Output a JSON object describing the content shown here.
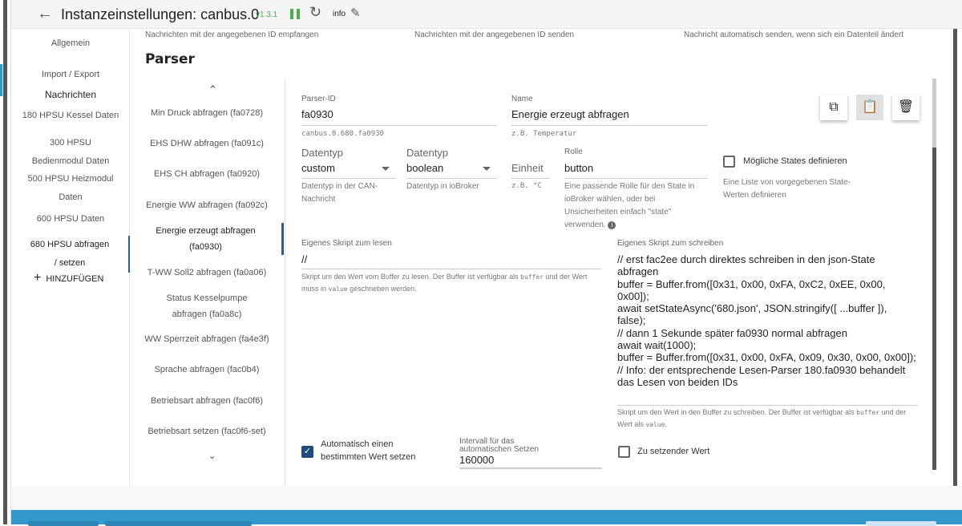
{
  "header": {
    "title": "Instanzeinstellungen: canbus.0",
    "version": "v1.3.1",
    "info": "info"
  },
  "nav": {
    "items": [
      "Allgemein",
      "Import / Export",
      "Nachrichten",
      "180 HPSU Kessel Daten",
      "300 HPSU Bedienmodul Daten",
      "500 HPSU Heizmodul Daten",
      "600 HPSU Daten",
      "680 HPSU abfragen / setzen"
    ],
    "add": "HINZUFÜGEN"
  },
  "top_desc": [
    "Nachrichten mit der angegebenen ID empfangen",
    "Nachrichten mit der angegebenen ID senden",
    "Nachricht automatisch senden, wenn sich ein Datenteil ändert"
  ],
  "section_title": "Parser",
  "parsers": [
    "Min Druck abfragen (fa0728)",
    "EHS DHW abfragen (fa091c)",
    "EHS CH abfragen (fa0920)",
    "Energie WW abfragen (fa092c)",
    "Energie erzeugt abfragen (fa0930)",
    "T-WW Soll2 abfragen (fa0a06)",
    "Status Kesselpumpe abfragen (fa0a8c)",
    "WW Sperrzeit abfragen (fa4e3f)",
    "Sprache abfragen (fac0b4)",
    "Betriebsart abfragen (fac0f6)",
    "Betriebsart setzen (fac0f6-set)"
  ],
  "form": {
    "parser_id": {
      "label": "Parser-ID",
      "value": "fa0930",
      "help": "canbus.0.680.fa0930"
    },
    "name": {
      "label": "Name",
      "value": "Energie erzeugt abfragen",
      "help": "z.B. Temperatur"
    },
    "can_type": {
      "label": "Datentyp",
      "value": "custom",
      "help": "Datentyp in der CAN-Nachricht"
    },
    "iob_type": {
      "label": "Datentyp",
      "value": "boolean",
      "help": "Datentyp in ioBroker"
    },
    "unit": {
      "label": "Einheit",
      "help": "z.B. °C"
    },
    "role": {
      "label": "Rolle",
      "value": "button",
      "help": "Eine passende Rolle für den State in ioBroker wählen, oder bei Unsicherheiten einfach \"state\" verwenden."
    },
    "states": {
      "label": "Mögliche States definieren",
      "help": "Eine Liste von vorgegebenen State-Werten definieren",
      "checked": false
    },
    "read_script": {
      "label": "Eigenes Skript zum lesen",
      "value": "//",
      "help_a": "Skript um den Wert vom Buffer zu lesen. Der Buffer ist verfügbar als ",
      "help_code1": "buffer",
      "help_b": " und der Wert muss in ",
      "help_code2": "value",
      "help_c": " geschrieben werden."
    },
    "write_script": {
      "label": "Eigenes Skript zum schreiben",
      "value": "// erst fac2ee durch direktes schreiben in den json-State abfragen\nbuffer = Buffer.from([0x31, 0x00, 0xFA, 0xC2, 0xEE, 0x00, 0x00]);\nawait setStateAsync('680.json', JSON.stringify([ ...buffer ]), false);\n// dann 1 Sekunde später fa0930 normal abfragen\nawait wait(1000);\nbuffer = Buffer.from([0x31, 0x00, 0xFA, 0x09, 0x30, 0x00, 0x00]);\n// Info: der entsprechende Lesen-Parser 180.fa0930 behandelt das Lesen von beiden IDs",
      "help_a": "Skript um den Wert in den Buffer zu schreiben. Der Buffer ist verfügbar als ",
      "help_code1": "buffer",
      "help_b": " und der Wert als ",
      "help_code2": "value",
      "help_c": "."
    },
    "auto_set": {
      "label": "Automatisch einen bestimmten Wert setzen",
      "checked": true
    },
    "interval": {
      "label": "Intervall für das automatischen Setzen",
      "value": "160000"
    },
    "set_value": {
      "label": "Zu setzender Wert",
      "checked": false
    }
  },
  "colors": {
    "accent": "#2a5d99",
    "running": "#4caf50",
    "bottom_bar": "#3399cc"
  }
}
